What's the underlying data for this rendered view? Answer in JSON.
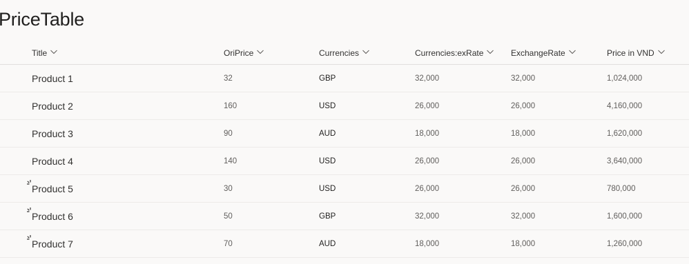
{
  "page": {
    "title": "PriceTable"
  },
  "columns": [
    "Title",
    "OriPrice",
    "Currencies",
    "Currencies:exRate",
    "ExchangeRate",
    "Price in VND"
  ],
  "rows": [
    {
      "title": "Product 1",
      "ori_price": "32",
      "currency": "GBP",
      "currency_ex_rate": "32,000",
      "exchange_rate": "32,000",
      "price_vnd": "1,024,000",
      "loading": false
    },
    {
      "title": "Product 2",
      "ori_price": "160",
      "currency": "USD",
      "currency_ex_rate": "26,000",
      "exchange_rate": "26,000",
      "price_vnd": "4,160,000",
      "loading": false
    },
    {
      "title": "Product 3",
      "ori_price": "90",
      "currency": "AUD",
      "currency_ex_rate": "18,000",
      "exchange_rate": "18,000",
      "price_vnd": "1,620,000",
      "loading": false
    },
    {
      "title": "Product 4",
      "ori_price": "140",
      "currency": "USD",
      "currency_ex_rate": "26,000",
      "exchange_rate": "26,000",
      "price_vnd": "3,640,000",
      "loading": false
    },
    {
      "title": "Product 5",
      "ori_price": "30",
      "currency": "USD",
      "currency_ex_rate": "26,000",
      "exchange_rate": "26,000",
      "price_vnd": "780,000",
      "loading": true
    },
    {
      "title": "Product 6",
      "ori_price": "50",
      "currency": "GBP",
      "currency_ex_rate": "32,000",
      "exchange_rate": "32,000",
      "price_vnd": "1,600,000",
      "loading": true
    },
    {
      "title": "Product 7",
      "ori_price": "70",
      "currency": "AUD",
      "currency_ex_rate": "18,000",
      "exchange_rate": "18,000",
      "price_vnd": "1,260,000",
      "loading": true
    }
  ],
  "icons": {
    "column_menu": "chevron-down-icon",
    "row_status": "loading-spinner-icon"
  },
  "colors": {
    "background": "#faf9f8",
    "text_primary": "#323130",
    "text_secondary": "#605e5c",
    "divider": "#edebe9"
  }
}
